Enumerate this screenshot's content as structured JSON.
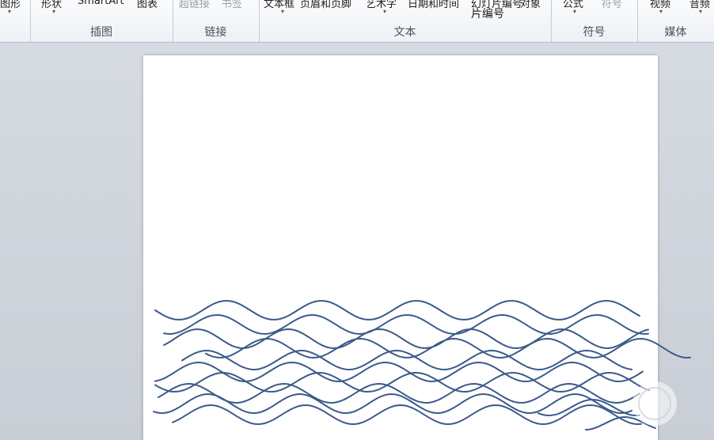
{
  "ribbon": {
    "groups": [
      {
        "label": "插图",
        "buttons": [
          {
            "text": "形状",
            "dim": false
          },
          {
            "text": "SmartArt",
            "dim": false
          },
          {
            "text": "图表",
            "dim": false
          }
        ]
      },
      {
        "label": "链接",
        "buttons": [
          {
            "text": "超链接",
            "dim": true
          },
          {
            "text": "书签",
            "dim": true
          }
        ]
      },
      {
        "label": "文本",
        "buttons": [
          {
            "text": "文本框",
            "dim": false
          },
          {
            "text": "页眉和页脚",
            "dim": false
          },
          {
            "text": "艺术字",
            "dim": false
          },
          {
            "text": "日期和时间",
            "dim": false
          },
          {
            "text": "幻灯片编号",
            "dim": false
          },
          {
            "text": "对象",
            "dim": false
          }
        ]
      },
      {
        "label": "符号",
        "buttons": [
          {
            "text": "公式",
            "dim": false
          },
          {
            "text": "符号",
            "dim": true
          }
        ]
      },
      {
        "label": "媒体",
        "buttons": [
          {
            "text": "视频",
            "dim": false
          },
          {
            "text": "音频",
            "dim": false
          }
        ]
      }
    ],
    "partial_left_text": "图形",
    "second_line_text": "片编号"
  },
  "canvas": {
    "wave_color": "#3a5a8a",
    "wave_count": 12
  },
  "watermark": {
    "icon": "baidu-watermark-icon"
  }
}
